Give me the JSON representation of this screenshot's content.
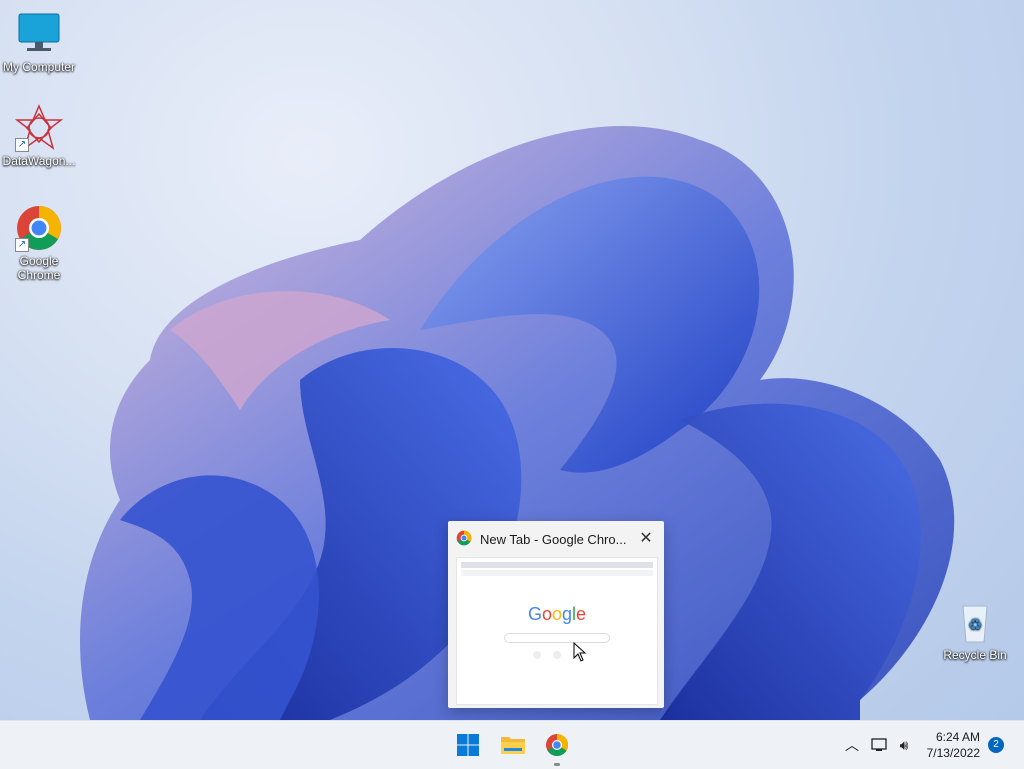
{
  "desktop": {
    "icons": [
      {
        "label": "My Computer"
      },
      {
        "label": "DataWagon..."
      },
      {
        "label": "Google Chrome"
      },
      {
        "label": "Recycle Bin"
      }
    ]
  },
  "preview": {
    "title": "New Tab - Google Chro...",
    "thumbnail_logo": "Google"
  },
  "taskbar": {
    "apps": [
      "start-button",
      "file-explorer",
      "google-chrome"
    ],
    "time": "6:24 AM",
    "date": "7/13/2022",
    "notification_count": "2"
  },
  "colors": {
    "accent": "#0067c0",
    "taskbar_bg": "#eef1f6"
  }
}
